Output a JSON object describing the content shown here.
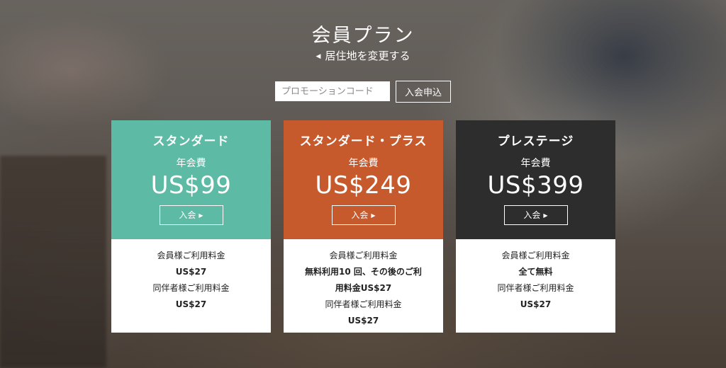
{
  "header": {
    "title": "会員プラン",
    "location_link": "居住地を変更する"
  },
  "promo": {
    "placeholder": "プロモーションコード",
    "join_label": "入会申込"
  },
  "plans": [
    {
      "name": "スタンダード",
      "fee_label": "年会費",
      "price": "US$99",
      "button_label": "入会",
      "color": "#5dbaa5",
      "details": [
        "会員様ご利用料金",
        "US$27",
        "同伴者様ご利用料金",
        "US$27"
      ]
    },
    {
      "name": "スタンダード・プラス",
      "fee_label": "年会費",
      "price": "US$249",
      "button_label": "入会",
      "color": "#c75a2c",
      "details": [
        "会員様ご利用料金",
        "無料利用10 回、その後のご利",
        "用料金US$27",
        "同伴者様ご利用料金",
        "US$27"
      ]
    },
    {
      "name": "プレステージ",
      "fee_label": "年会費",
      "price": "US$399",
      "button_label": "入会",
      "color": "#2e2d2d",
      "details": [
        "会員様ご利用料金",
        "全て無料",
        "同伴者様ご利用料金",
        "US$27"
      ]
    }
  ]
}
